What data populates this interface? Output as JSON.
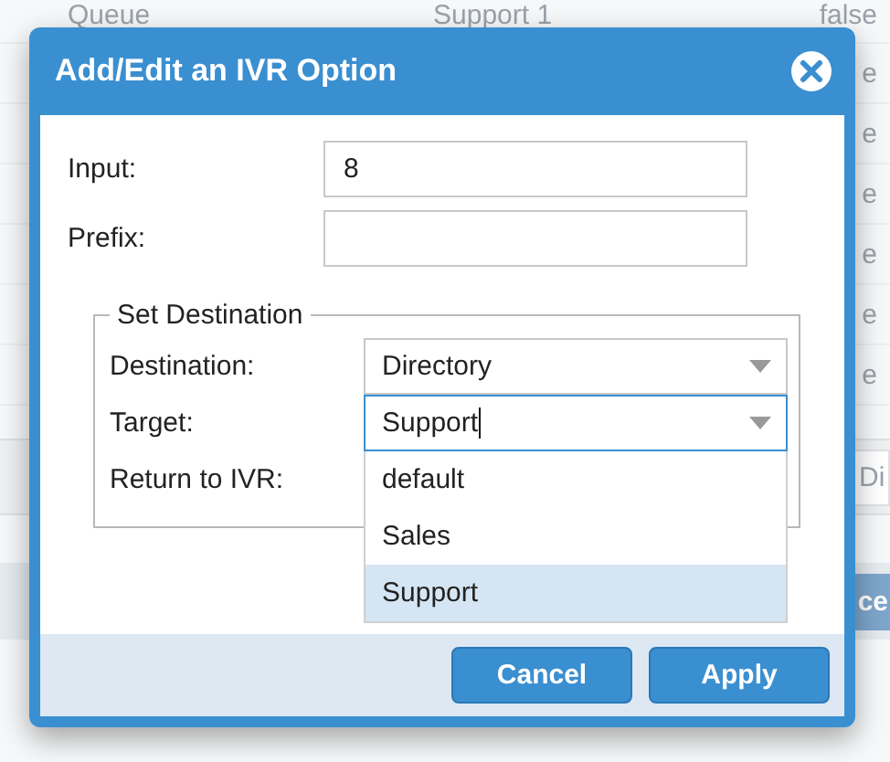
{
  "background": {
    "rows": [
      {
        "column_1": "Queue",
        "column_2": "Support 1",
        "column_3": "false"
      },
      {
        "column_3": "e"
      },
      {
        "column_3": "e"
      },
      {
        "column_3": "e"
      },
      {
        "column_3": "e"
      },
      {
        "column_3": "e"
      },
      {
        "column_3": "e"
      }
    ],
    "field_fragment": "Di",
    "button_fragment": "ce"
  },
  "dialog": {
    "title": "Add/Edit an IVR Option",
    "fields": [
      {
        "label": "Input:",
        "value": "8"
      },
      {
        "label": "Prefix:"
      }
    ],
    "destination": {
      "legend": "Set Destination",
      "rows": [
        {
          "kind": "select",
          "label": "Destination:",
          "value": "Directory",
          "focused": false,
          "open": false
        },
        {
          "kind": "select",
          "label": "Target:",
          "value": "Support",
          "focused": true,
          "open": true,
          "options": [
            {
              "label": "default",
              "selected": false
            },
            {
              "label": "Sales",
              "selected": false
            },
            {
              "label": "Support",
              "selected": true
            }
          ]
        },
        {
          "kind": "label",
          "label": "Return to IVR:"
        }
      ]
    },
    "buttons": [
      "Cancel",
      "Apply"
    ]
  }
}
